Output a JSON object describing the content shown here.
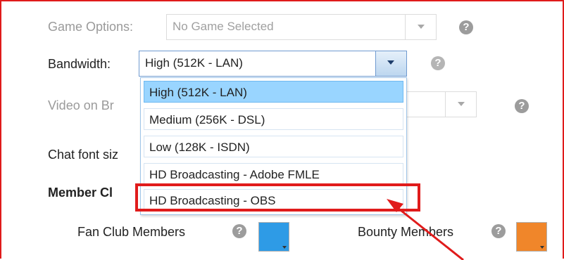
{
  "settings": {
    "game_options": {
      "label": "Game Options:",
      "value": "No Game Selected"
    },
    "bandwidth": {
      "label": "Bandwidth:",
      "value": "High (512K - LAN)"
    },
    "video_on_broadcast": {
      "label": "Video on Br"
    },
    "chat_font_size": {
      "label": "Chat font siz"
    },
    "member_colors": {
      "label": "Member Cl"
    },
    "fan_club_members": {
      "label": "Fan Club Members",
      "color": "#2e9be6"
    },
    "bounty_members": {
      "label": "Bounty Members",
      "color": "#f0862a"
    }
  },
  "help_icon_glyph": "?",
  "bandwidth_dropdown": {
    "options": [
      {
        "label": "High (512K - LAN)",
        "selected": true
      },
      {
        "label": "Medium (256K - DSL)",
        "selected": false
      },
      {
        "label": "Low (128K - ISDN)",
        "selected": false
      },
      {
        "label": "HD Broadcasting - Adobe FMLE",
        "selected": false
      },
      {
        "label": "HD Broadcasting - OBS",
        "selected": false
      }
    ]
  },
  "annotation": {
    "highlight_color": "#e01b1b",
    "highlighted_option": "HD Broadcasting - OBS"
  }
}
